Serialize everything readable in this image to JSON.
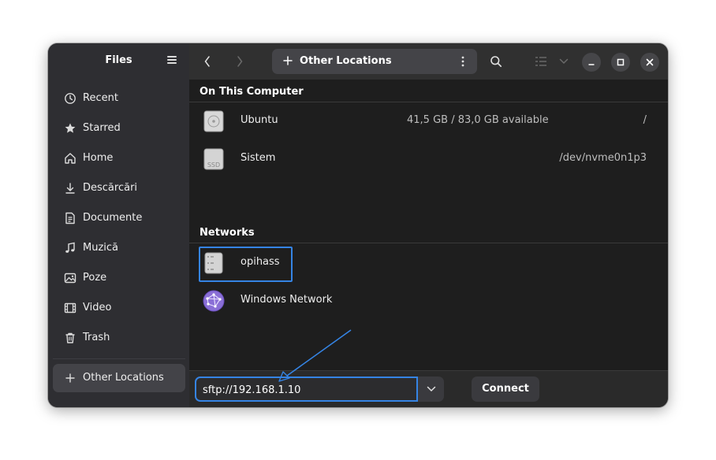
{
  "sidebar": {
    "title": "Files",
    "items": [
      {
        "label": "Recent",
        "icon": "clock-icon"
      },
      {
        "label": "Starred",
        "icon": "star-icon"
      },
      {
        "label": "Home",
        "icon": "home-icon"
      },
      {
        "label": "Descărcări",
        "icon": "download-icon"
      },
      {
        "label": "Documente",
        "icon": "document-icon"
      },
      {
        "label": "Muzică",
        "icon": "music-icon"
      },
      {
        "label": "Poze",
        "icon": "picture-icon"
      },
      {
        "label": "Video",
        "icon": "video-icon"
      },
      {
        "label": "Trash",
        "icon": "trash-icon"
      }
    ],
    "other_locations": "Other Locations"
  },
  "header": {
    "location_title": "Other Locations"
  },
  "content": {
    "section_computer": "On This Computer",
    "computer_items": [
      {
        "name": "Ubuntu",
        "available": "41,5 GB / 83,0 GB available",
        "mount": "/",
        "icon": "disk-icon"
      },
      {
        "name": "Sistem",
        "available": "",
        "mount": "/dev/nvme0n1p3",
        "icon": "ssd-icon"
      }
    ],
    "section_networks": "Networks",
    "network_items": [
      {
        "name": "opihass",
        "icon": "server-icon"
      },
      {
        "name": "Windows Network",
        "icon": "network-icon"
      }
    ],
    "ssd_label": "SSD"
  },
  "bottom": {
    "address_value": "sftp://192.168.1.10",
    "help_glyph": "?",
    "connect_label": "Connect"
  },
  "colors": {
    "accent": "#3584e4",
    "sidebar_bg": "#2e2e32",
    "content_bg": "#1e1e1e"
  }
}
